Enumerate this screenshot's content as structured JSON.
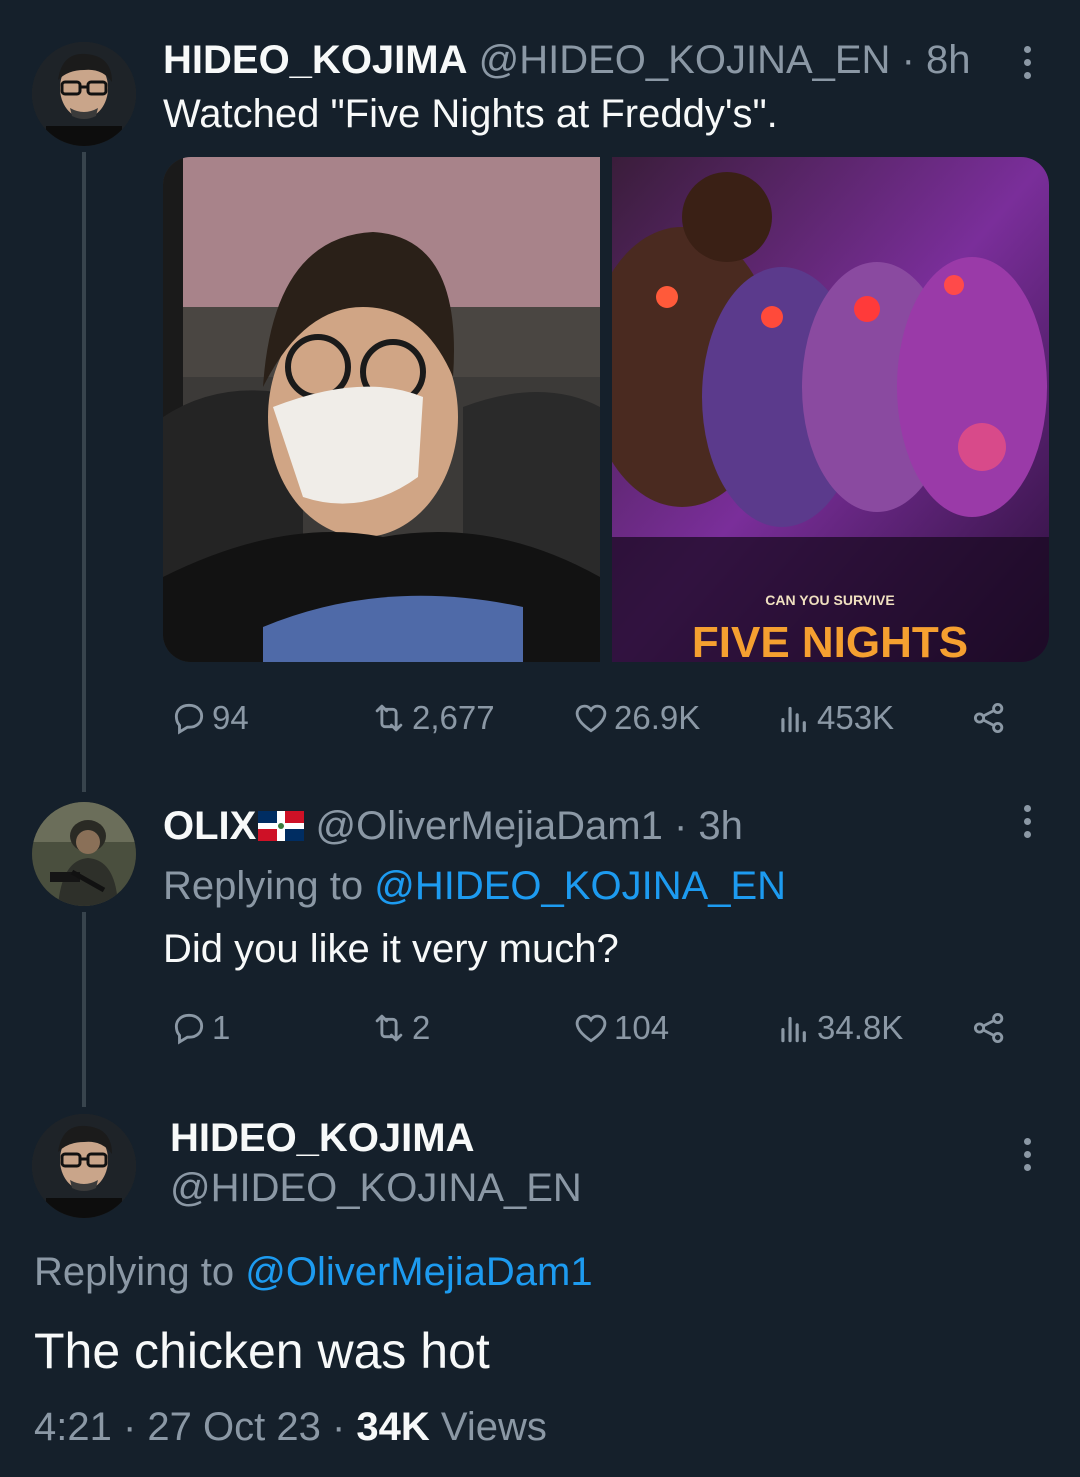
{
  "colors": {
    "background": "#15202b",
    "link": "#1d9bf0",
    "secondary": "#8b98a5"
  },
  "tweet1": {
    "name": "HIDEO_KOJIMA",
    "handle": "@HIDEO_KOJINA_EN",
    "time": "· 8h",
    "text": "Watched \"Five Nights at Freddy's\".",
    "media": {
      "left_image": "photo of man wearing glasses and face mask in cinema seat",
      "poster_tagline": "CAN YOU SURVIVE",
      "poster_title": "FIVE NIGHTS"
    },
    "stats": {
      "replies": "94",
      "reposts": "2,677",
      "likes": "26.9K",
      "views": "453K"
    }
  },
  "tweet2": {
    "name": "OLIX",
    "flag": "dominican-republic-flag-icon",
    "handle": "@OliverMejiaDam1",
    "time": "· 3h",
    "replying_label": "Replying to",
    "replying_handle": "@HIDEO_KOJINA_EN",
    "text": "Did you like it very much?",
    "stats": {
      "replies": "1",
      "reposts": "2",
      "likes": "104",
      "views": "34.8K"
    }
  },
  "tweet3": {
    "name": "HIDEO_KOJIMA",
    "handle": "@HIDEO_KOJINA_EN",
    "replying_label": "Replying to",
    "replying_handle": "@OliverMejiaDam1",
    "text": "The chicken was hot",
    "meta_time": "4:21 · 27 Oct 23 ·",
    "views_count": "34K",
    "views_label": "Views"
  }
}
